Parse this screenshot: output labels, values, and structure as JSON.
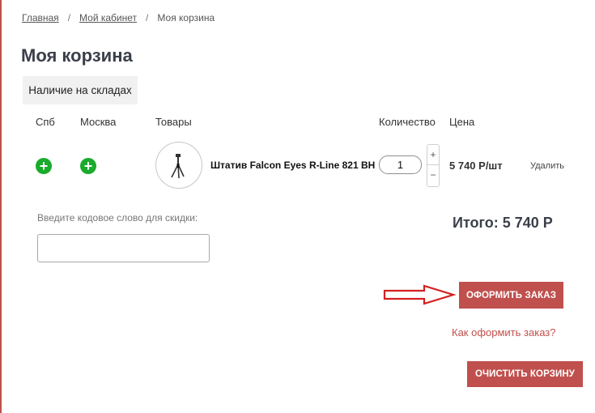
{
  "breadcrumb": {
    "home": "Главная",
    "cabinet": "Мой кабинет",
    "current": "Моя корзина",
    "separator": "/"
  },
  "page_title": "Моя корзина",
  "stock_tab": "Наличие на складах",
  "table_headers": {
    "spb": "Спб",
    "moscow": "Москва",
    "products": "Товары",
    "quantity": "Количество",
    "price": "Цена"
  },
  "cart_items": [
    {
      "spb_available": "+",
      "moscow_available": "+",
      "name": "Штатив Falcon Eyes R-Line 821 BH",
      "quantity": "1",
      "price": "5 740 Р/шт",
      "delete_label": "Удалить"
    }
  ],
  "stepper": {
    "plus": "+",
    "minus": "−"
  },
  "promo": {
    "label": "Введите кодовое слово для скидки:",
    "value": ""
  },
  "total": "Итого: 5 740 Р",
  "order_button": "ОФОРМИТЬ ЗАКАЗ",
  "how_to_order": "Как оформить заказ?",
  "clear_button": "ОЧИСТИТЬ КОРЗИНУ",
  "colors": {
    "accent": "#c0504d",
    "available": "#1aab2c",
    "title": "#3b3f4a",
    "annotation_arrow": "#d42020"
  },
  "icons": {
    "availability": "plus-circle-icon",
    "annotation": "right-arrow-icon",
    "product": "tripod-image"
  }
}
